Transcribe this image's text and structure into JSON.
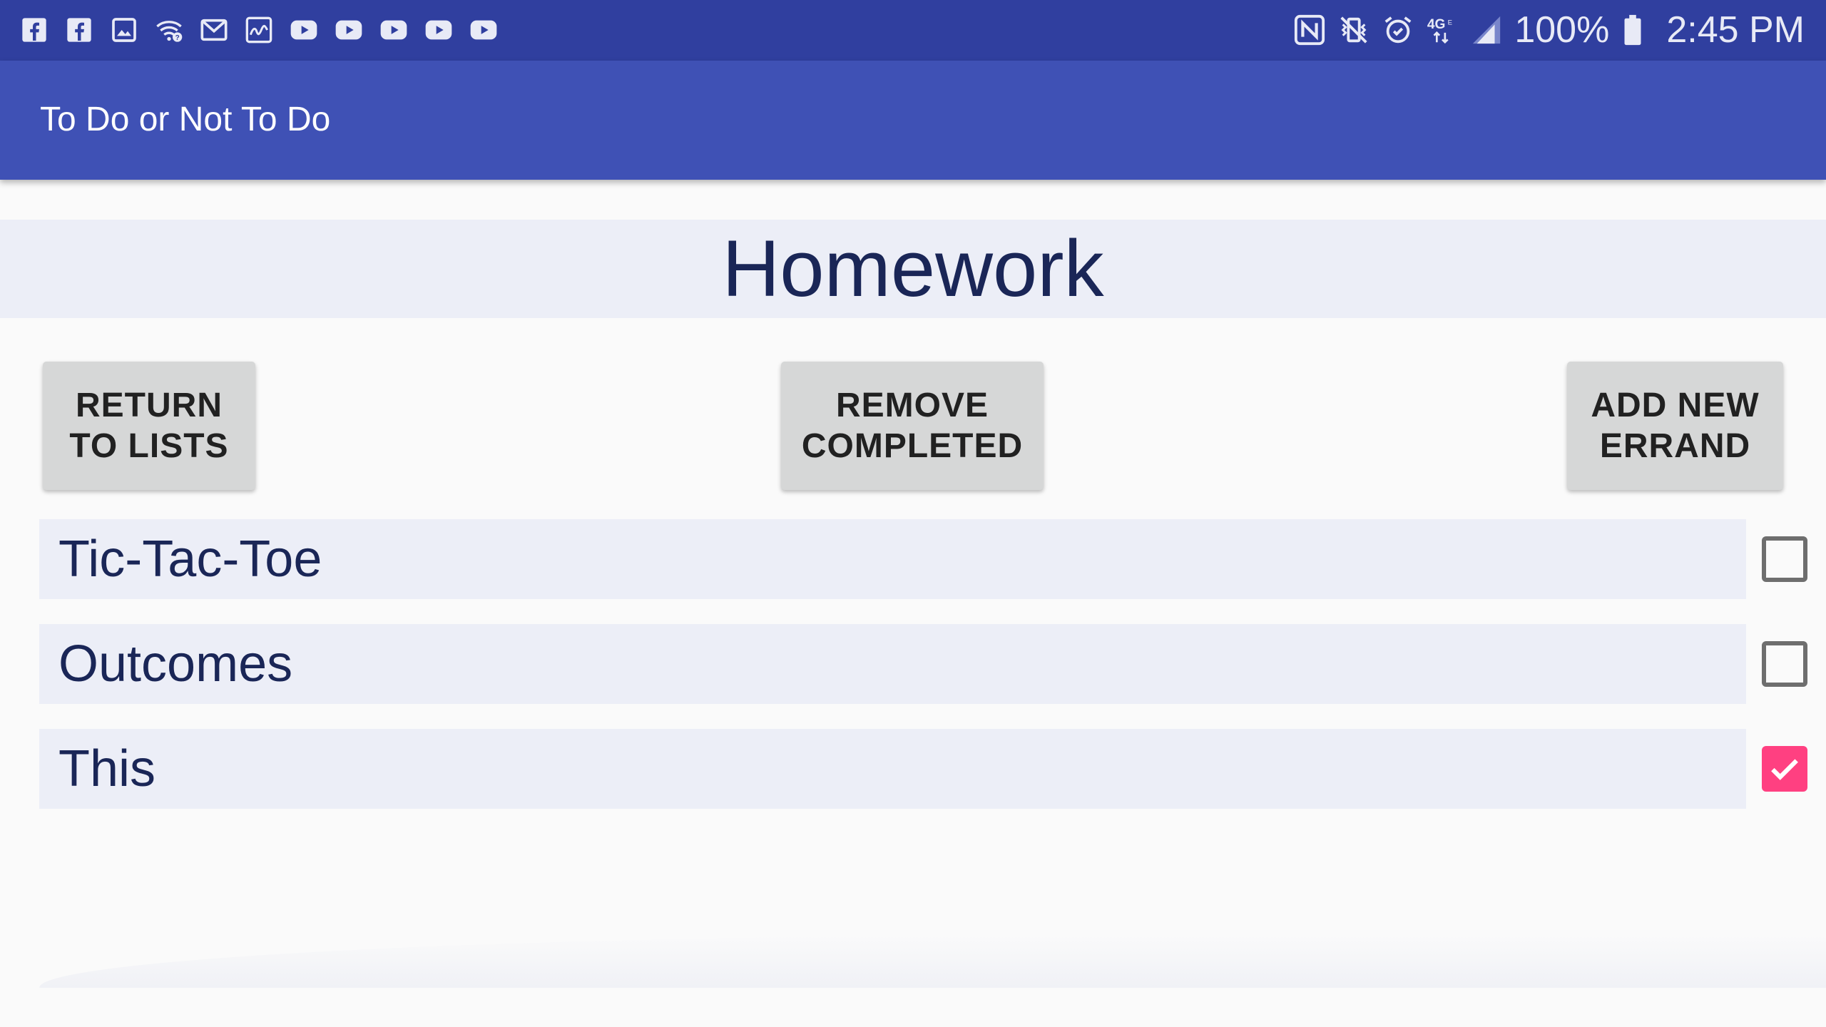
{
  "status_bar": {
    "left_icons": [
      "facebook-icon",
      "facebook-icon",
      "gallery-icon",
      "wifi-question-icon",
      "gmail-icon",
      "photo-editor-icon",
      "youtube-icon",
      "youtube-icon",
      "youtube-icon",
      "youtube-icon",
      "youtube-icon"
    ],
    "right_icons": [
      "nfc-icon",
      "vibrate-mute-icon",
      "alarm-icon",
      "lte-4g-icon",
      "cell-signal-icon"
    ],
    "battery": "100%",
    "time": "2:45 PM"
  },
  "app_bar": {
    "title": "To Do or Not To Do"
  },
  "list": {
    "title": "Homework"
  },
  "buttons": {
    "return": "RETURN\nTO LISTS",
    "remove": "REMOVE\nCOMPLETED",
    "add": "ADD NEW\nERRAND"
  },
  "items": [
    {
      "label": "Tic-Tac-Toe",
      "checked": false
    },
    {
      "label": "Outcomes",
      "checked": false
    },
    {
      "label": "This",
      "checked": true
    }
  ],
  "colors": {
    "status_bar": "#303f9f",
    "app_bar": "#3f51b5",
    "accent": "#ff4081",
    "item_background": "#eceef7"
  }
}
